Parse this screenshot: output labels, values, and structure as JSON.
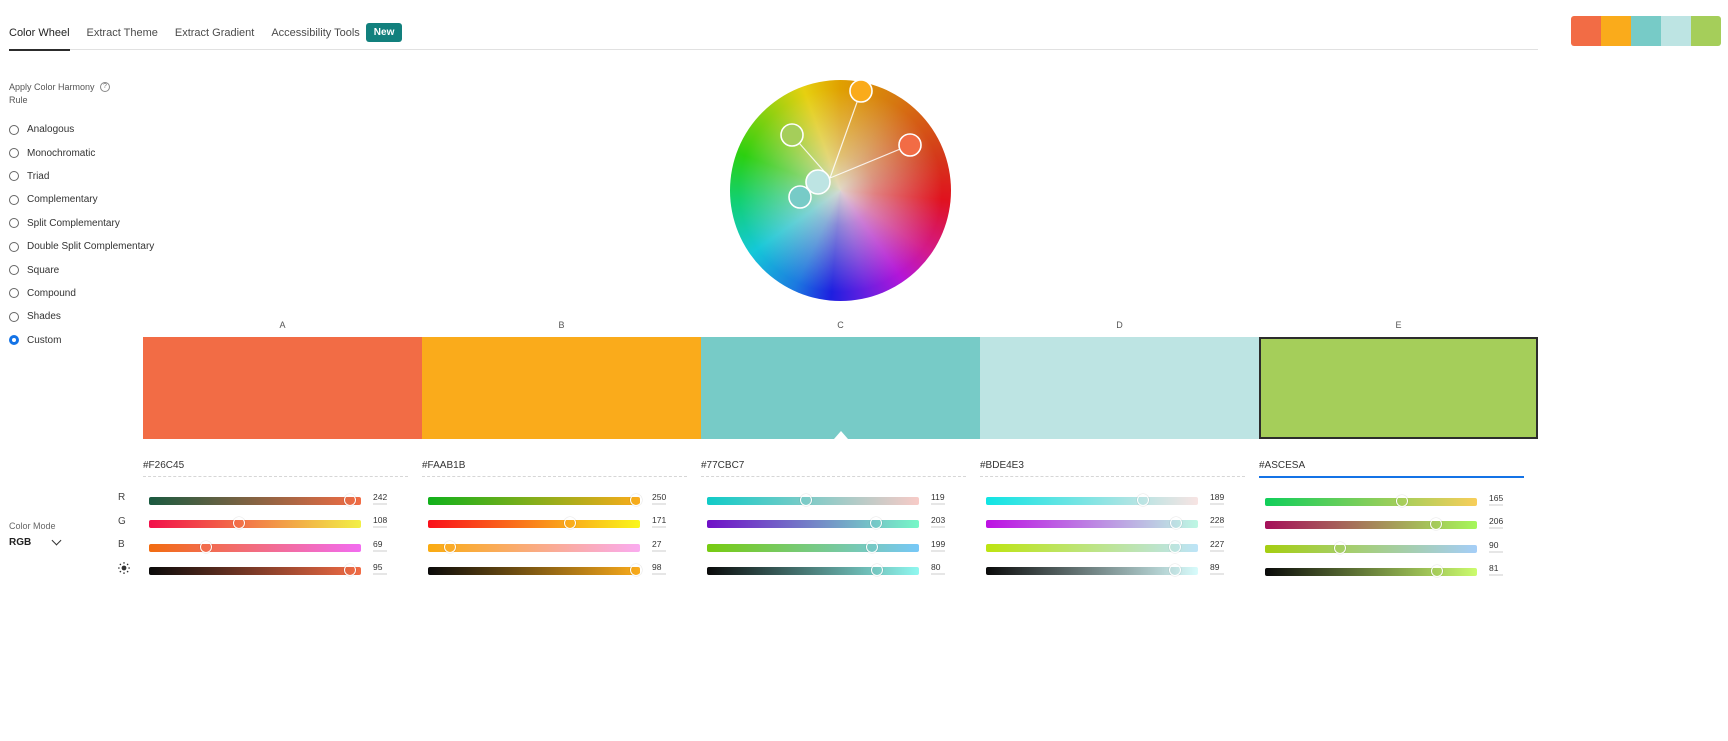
{
  "tabs": [
    {
      "label": "Color Wheel",
      "active": true
    },
    {
      "label": "Extract Theme",
      "active": false
    },
    {
      "label": "Extract Gradient",
      "active": false
    },
    {
      "label": "Accessibility Tools",
      "active": false
    }
  ],
  "new_badge": "New",
  "mini_palette": [
    "#F26C45",
    "#FAAB1B",
    "#77CBC7",
    "#BDE4E3",
    "#A5CE5A"
  ],
  "harmony": {
    "heading": "Apply Color Harmony Rule",
    "help_icon": "?",
    "rules": [
      {
        "label": "Analogous",
        "checked": false
      },
      {
        "label": "Monochromatic",
        "checked": false
      },
      {
        "label": "Triad",
        "checked": false
      },
      {
        "label": "Complementary",
        "checked": false
      },
      {
        "label": "Split Complementary",
        "checked": false
      },
      {
        "label": "Double Split Complementary",
        "checked": false
      },
      {
        "label": "Square",
        "checked": false
      },
      {
        "label": "Compound",
        "checked": false
      },
      {
        "label": "Shades",
        "checked": false
      },
      {
        "label": "Custom",
        "checked": true
      }
    ]
  },
  "wheel": {
    "handles": [
      {
        "swatch": "A",
        "color": "#F26C45"
      },
      {
        "swatch": "B",
        "color": "#FAAB1B"
      },
      {
        "swatch": "C",
        "color": "#77CBC7"
      },
      {
        "swatch": "D",
        "color": "#BDE4E3"
      },
      {
        "swatch": "E",
        "color": "#A5CE5A"
      }
    ]
  },
  "color_mode": {
    "label": "Color Mode",
    "value": "RGB"
  },
  "channel_labels": [
    "R",
    "G",
    "B",
    "brightness"
  ],
  "swatches": [
    {
      "label": "A",
      "color": "#F26C45",
      "hex_display": "#F26C45",
      "selected": false,
      "focused": false,
      "hex_active": false,
      "sliders": [
        {
          "channel": "R",
          "value": 242,
          "max": 255,
          "gradient": [
            "#1a5a40",
            "#f26c45"
          ]
        },
        {
          "channel": "G",
          "value": 108,
          "max": 255,
          "gradient": [
            "#f2104a",
            "#f2f045"
          ]
        },
        {
          "channel": "B",
          "value": 69,
          "max": 255,
          "gradient": [
            "#f26c10",
            "#f26cf0"
          ]
        },
        {
          "channel": "Brightness",
          "value": 95,
          "max": 100,
          "gradient": [
            "#0a0a0a",
            "#f26c45"
          ]
        }
      ]
    },
    {
      "label": "B",
      "color": "#FAAB1B",
      "hex_display": "#FAAB1B",
      "selected": false,
      "focused": false,
      "hex_active": false,
      "sliders": [
        {
          "channel": "R",
          "value": 250,
          "max": 255,
          "gradient": [
            "#10b01b",
            "#faab1b"
          ]
        },
        {
          "channel": "G",
          "value": 171,
          "max": 255,
          "gradient": [
            "#fa101b",
            "#faf81b"
          ]
        },
        {
          "channel": "B",
          "value": 27,
          "max": 255,
          "gradient": [
            "#faab10",
            "#faabf0"
          ]
        },
        {
          "channel": "Brightness",
          "value": 98,
          "max": 100,
          "gradient": [
            "#0a0a0a",
            "#faab1b"
          ]
        }
      ]
    },
    {
      "label": "C",
      "color": "#77CBC7",
      "hex_display": "#77CBC7",
      "selected": true,
      "focused": false,
      "hex_active": false,
      "sliders": [
        {
          "channel": "R",
          "value": 119,
          "max": 255,
          "gradient": [
            "#10cbc7",
            "#f8cbc7"
          ]
        },
        {
          "channel": "G",
          "value": 203,
          "max": 255,
          "gradient": [
            "#7010c7",
            "#77f8c7"
          ]
        },
        {
          "channel": "B",
          "value": 199,
          "max": 255,
          "gradient": [
            "#77cb10",
            "#77c8f8"
          ]
        },
        {
          "channel": "Brightness",
          "value": 80,
          "max": 100,
          "gradient": [
            "#0a0a0a",
            "#90f8f0"
          ]
        }
      ]
    },
    {
      "label": "D",
      "color": "#BDE4E3",
      "hex_display": "#BDE4E3",
      "selected": false,
      "focused": false,
      "hex_active": false,
      "sliders": [
        {
          "channel": "R",
          "value": 189,
          "max": 255,
          "gradient": [
            "#10e4e3",
            "#f8e4e3"
          ]
        },
        {
          "channel": "G",
          "value": 228,
          "max": 255,
          "gradient": [
            "#bd10e3",
            "#bdf8e3"
          ]
        },
        {
          "channel": "B",
          "value": 227,
          "max": 255,
          "gradient": [
            "#bde410",
            "#bde4f8"
          ]
        },
        {
          "channel": "Brightness",
          "value": 89,
          "max": 100,
          "gradient": [
            "#0a0a0a",
            "#d8fcfc"
          ]
        }
      ]
    },
    {
      "label": "E",
      "color": "#A5CE5A",
      "hex_display": "#ASCESA",
      "selected": false,
      "focused": true,
      "hex_active": true,
      "sliders": [
        {
          "channel": "R",
          "value": 165,
          "max": 255,
          "gradient": [
            "#10ce5a",
            "#f8ce5a"
          ]
        },
        {
          "channel": "G",
          "value": 206,
          "max": 255,
          "gradient": [
            "#a5105a",
            "#a5f85a"
          ]
        },
        {
          "channel": "B",
          "value": 90,
          "max": 255,
          "gradient": [
            "#a5ce10",
            "#a5cef8"
          ]
        },
        {
          "channel": "Brightness",
          "value": 81,
          "max": 100,
          "gradient": [
            "#0a0a0a",
            "#ccfc6e"
          ]
        }
      ]
    }
  ]
}
